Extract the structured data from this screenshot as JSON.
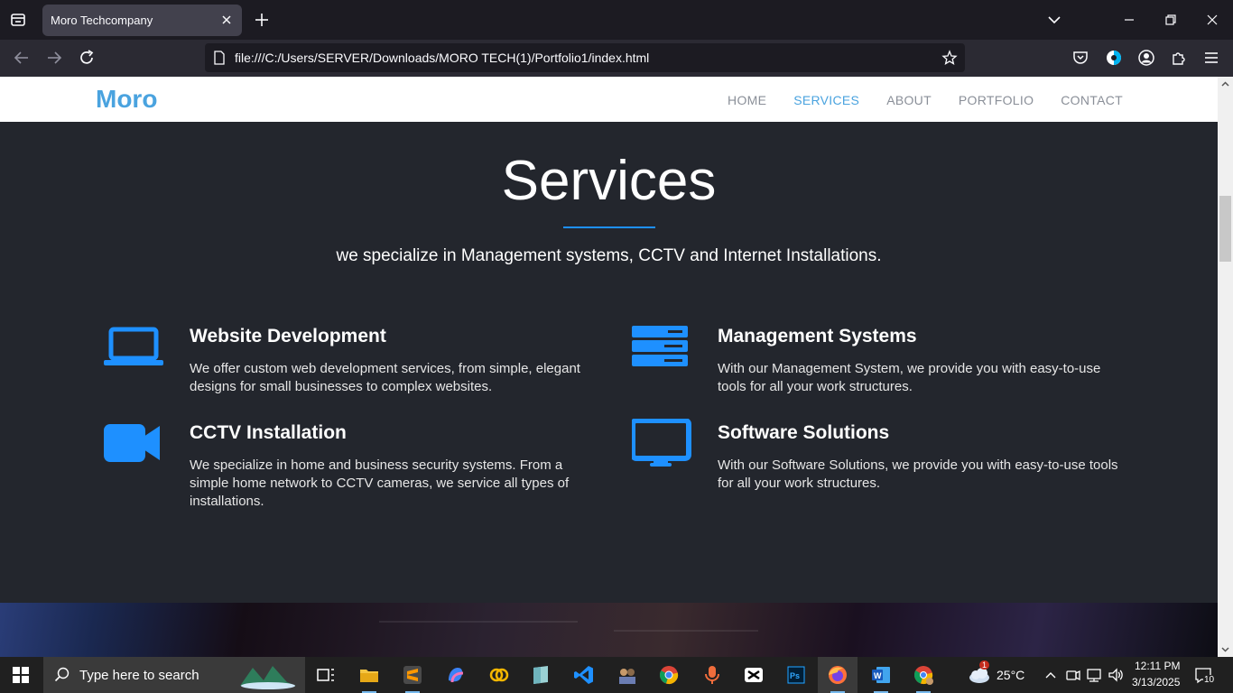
{
  "browser": {
    "tab_title": "Moro Techcompany",
    "url": "file:///C:/Users/SERVER/Downloads/MORO TECH(1)/Portfolio1/index.html"
  },
  "site": {
    "logo": "Moro",
    "nav": [
      {
        "label": "HOME",
        "active": false
      },
      {
        "label": "SERVICES",
        "active": true
      },
      {
        "label": "ABOUT",
        "active": false
      },
      {
        "label": "PORTFOLIO",
        "active": false
      },
      {
        "label": "CONTACT",
        "active": false
      }
    ],
    "accent": "#4aa3df"
  },
  "services": {
    "title": "Services",
    "subtitle": "we specialize in Management systems, CCTV and Internet Installations.",
    "items": [
      {
        "icon": "laptop-icon",
        "title": "Website Development",
        "text": "We offer custom web development services, from simple, elegant designs for small businesses to complex websites."
      },
      {
        "icon": "server-icon",
        "title": "Management Systems",
        "text": "With our Management System, we provide you with easy-to-use tools for all your work structures."
      },
      {
        "icon": "video-camera-icon",
        "title": "CCTV Installation",
        "text": "We specialize in home and business security systems. From a simple home network to CCTV cameras, we service all types of installations."
      },
      {
        "icon": "monitor-icon",
        "title": "Software Solutions",
        "text": "With our Software Solutions, we provide you with easy-to-use tools for all your work structures."
      }
    ],
    "icon_color": "#1e90ff"
  },
  "taskbar": {
    "search_placeholder": "Type here to search",
    "weather": "25°C",
    "weather_badge": "1",
    "time": "12:11 PM",
    "date": "3/13/2025",
    "notifications": "10"
  }
}
